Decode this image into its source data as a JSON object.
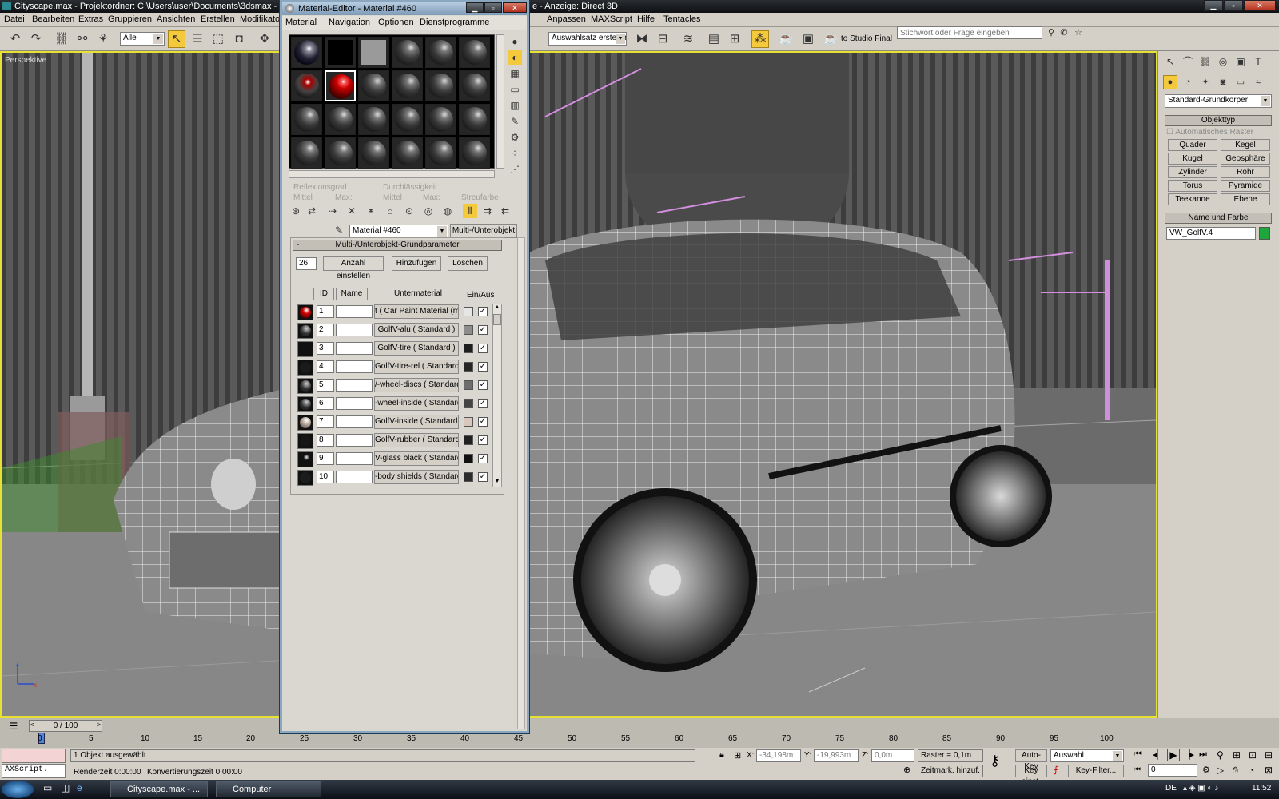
{
  "app": {
    "title": "Cityscape.max   - Projektordner: C:\\Users\\user\\Documents\\3dsmax   -",
    "title_right": "e - Anzeige: Direct 3D"
  },
  "menus": [
    "Datei",
    "Bearbeiten",
    "Extras",
    "Gruppieren",
    "Ansichten",
    "Erstellen",
    "Modifikatoren"
  ],
  "menus_right": [
    "Anpassen",
    "MAXScript",
    "Hilfe",
    "Tentacles"
  ],
  "toolbar": {
    "selection_filter": "Alle",
    "named_selection": "Auswahlsatz erstellen",
    "studio_label": "to Studio Final",
    "help_search_placeholder": "Stichwort oder Frage eingeben"
  },
  "viewport": {
    "label": "Perspektive"
  },
  "command_panel": {
    "dropdown": "Standard-Grundkörper",
    "objekttyp": {
      "header": "Objekttyp",
      "autogrid": "Automatisches Raster",
      "buttons": [
        "Quader",
        "Kegel",
        "Kugel",
        "Geosphäre",
        "Zylinder",
        "Rohr",
        "Torus",
        "Pyramide",
        "Teekanne",
        "Ebene"
      ]
    },
    "name_color": {
      "header": "Name und Farbe",
      "name": "VW_GolfV.4",
      "color": "#1da63a"
    }
  },
  "material_editor": {
    "title": "Material-Editor - Material #460",
    "menus": [
      "Material",
      "Navigation",
      "Optionen",
      "Dienstprogramme"
    ],
    "dim_labels": [
      "Reflexionsgrad",
      "Durchlässigkeit",
      "Mittel",
      "Max:",
      "Mittel",
      "Max:",
      "Streufarbe"
    ],
    "material_name": "Material #460",
    "material_type": "Multi-/Unterobjekt",
    "rollout_title": "Multi-/Unterobjekt-Grundparameter",
    "count": "26",
    "btn_set_count": "Anzahl einstellen",
    "btn_add": "Hinzufügen",
    "btn_delete": "Löschen",
    "col_id": "ID",
    "col_name": "Name",
    "col_sub": "Untermaterial",
    "col_onoff": "Ein/Aus",
    "rows": [
      {
        "id": "1",
        "sub": "t  ( Car Paint Material (mi) )",
        "color": "#e6e6e6",
        "check": "✓"
      },
      {
        "id": "2",
        "sub": "GolfV-alu  ( Standard )",
        "color": "#8d8d8d",
        "check": "✓"
      },
      {
        "id": "3",
        "sub": "GolfV-tire  ( Standard )",
        "color": "#1e1e1e",
        "check": "✓"
      },
      {
        "id": "4",
        "sub": "GolfV-tire-rel  ( Standard )",
        "color": "#262626",
        "check": "✓"
      },
      {
        "id": "5",
        "sub": "/-wheel-discs  ( Standard )",
        "color": "#6e6e6e",
        "check": "✓"
      },
      {
        "id": "6",
        "sub": "-wheel-inside  ( Standard )",
        "color": "#444444",
        "check": "✓"
      },
      {
        "id": "7",
        "sub": "GolfV-inside  ( Standard )",
        "color": "#d8c7bb",
        "check": "✓"
      },
      {
        "id": "8",
        "sub": "GolfV-rubber  ( Standard )",
        "color": "#202020",
        "check": "✓"
      },
      {
        "id": "9",
        "sub": "V-glass black  ( Standard )",
        "color": "#111111",
        "check": "✓"
      },
      {
        "id": "10",
        "sub": "-body shields  ( Standard )",
        "color": "#2c2c2c",
        "check": "✓"
      }
    ]
  },
  "timeline": {
    "frame": "0 / 100",
    "ticks": [
      "0",
      "5",
      "10",
      "15",
      "20",
      "25",
      "30",
      "35",
      "40",
      "45",
      "50",
      "55",
      "60",
      "65",
      "70",
      "75",
      "80",
      "85",
      "90",
      "95",
      "100"
    ]
  },
  "status": {
    "script_label": "AXScript.",
    "selected": "1 Objekt ausgewählt",
    "render_time": "Renderzeit  0:00:00",
    "convert_time": "Konvertierungszeit  0:00:00",
    "x_label": "X:",
    "x_value": "-34,198m",
    "y_label": "Y:",
    "y_value": "-19,993m",
    "z_label": "Z:",
    "z_value": "0,0m",
    "grid": "Raster = 0,1m",
    "add_time_tag": "Zeitmark. hinzuf.",
    "auto_key": "Auto-Key",
    "set_key": "Key einst.",
    "selection_mode": "Auswahl",
    "key_filter": "Key-Filter...",
    "frame_field": "0"
  },
  "taskbar": {
    "task1": "Cityscape.max - ...",
    "task2": "Computer",
    "lang": "DE",
    "clock": "11:52"
  }
}
